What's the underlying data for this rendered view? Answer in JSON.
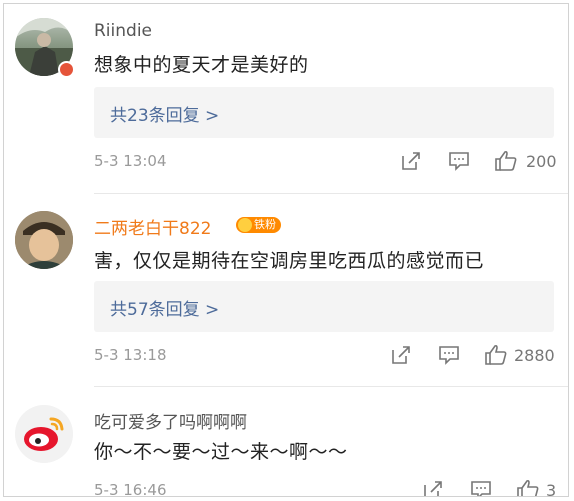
{
  "comments": [
    {
      "username": "Riindie",
      "text": "想象中的夏天才是美好的",
      "replies_label": "共23条回复 >",
      "time": "5-3 13:04",
      "likes": "200"
    },
    {
      "username": "二两老白干822",
      "badge_label": "铁粉",
      "text": "害，仅仅是期待在空调房里吃西瓜的感觉而已",
      "replies_label": "共57条回复 >",
      "time": "5-3 13:18",
      "likes": "2880"
    },
    {
      "username": "吃可爱多了吗啊啊啊",
      "text": "你～不～要～过～来～啊～～",
      "time": "5-3 16:46",
      "likes": "3"
    }
  ],
  "colors": {
    "username_default": "#555555",
    "username_vip": "#f07a1a",
    "reply_link": "#4d6b9a",
    "meta_text": "#9a9a9a"
  }
}
